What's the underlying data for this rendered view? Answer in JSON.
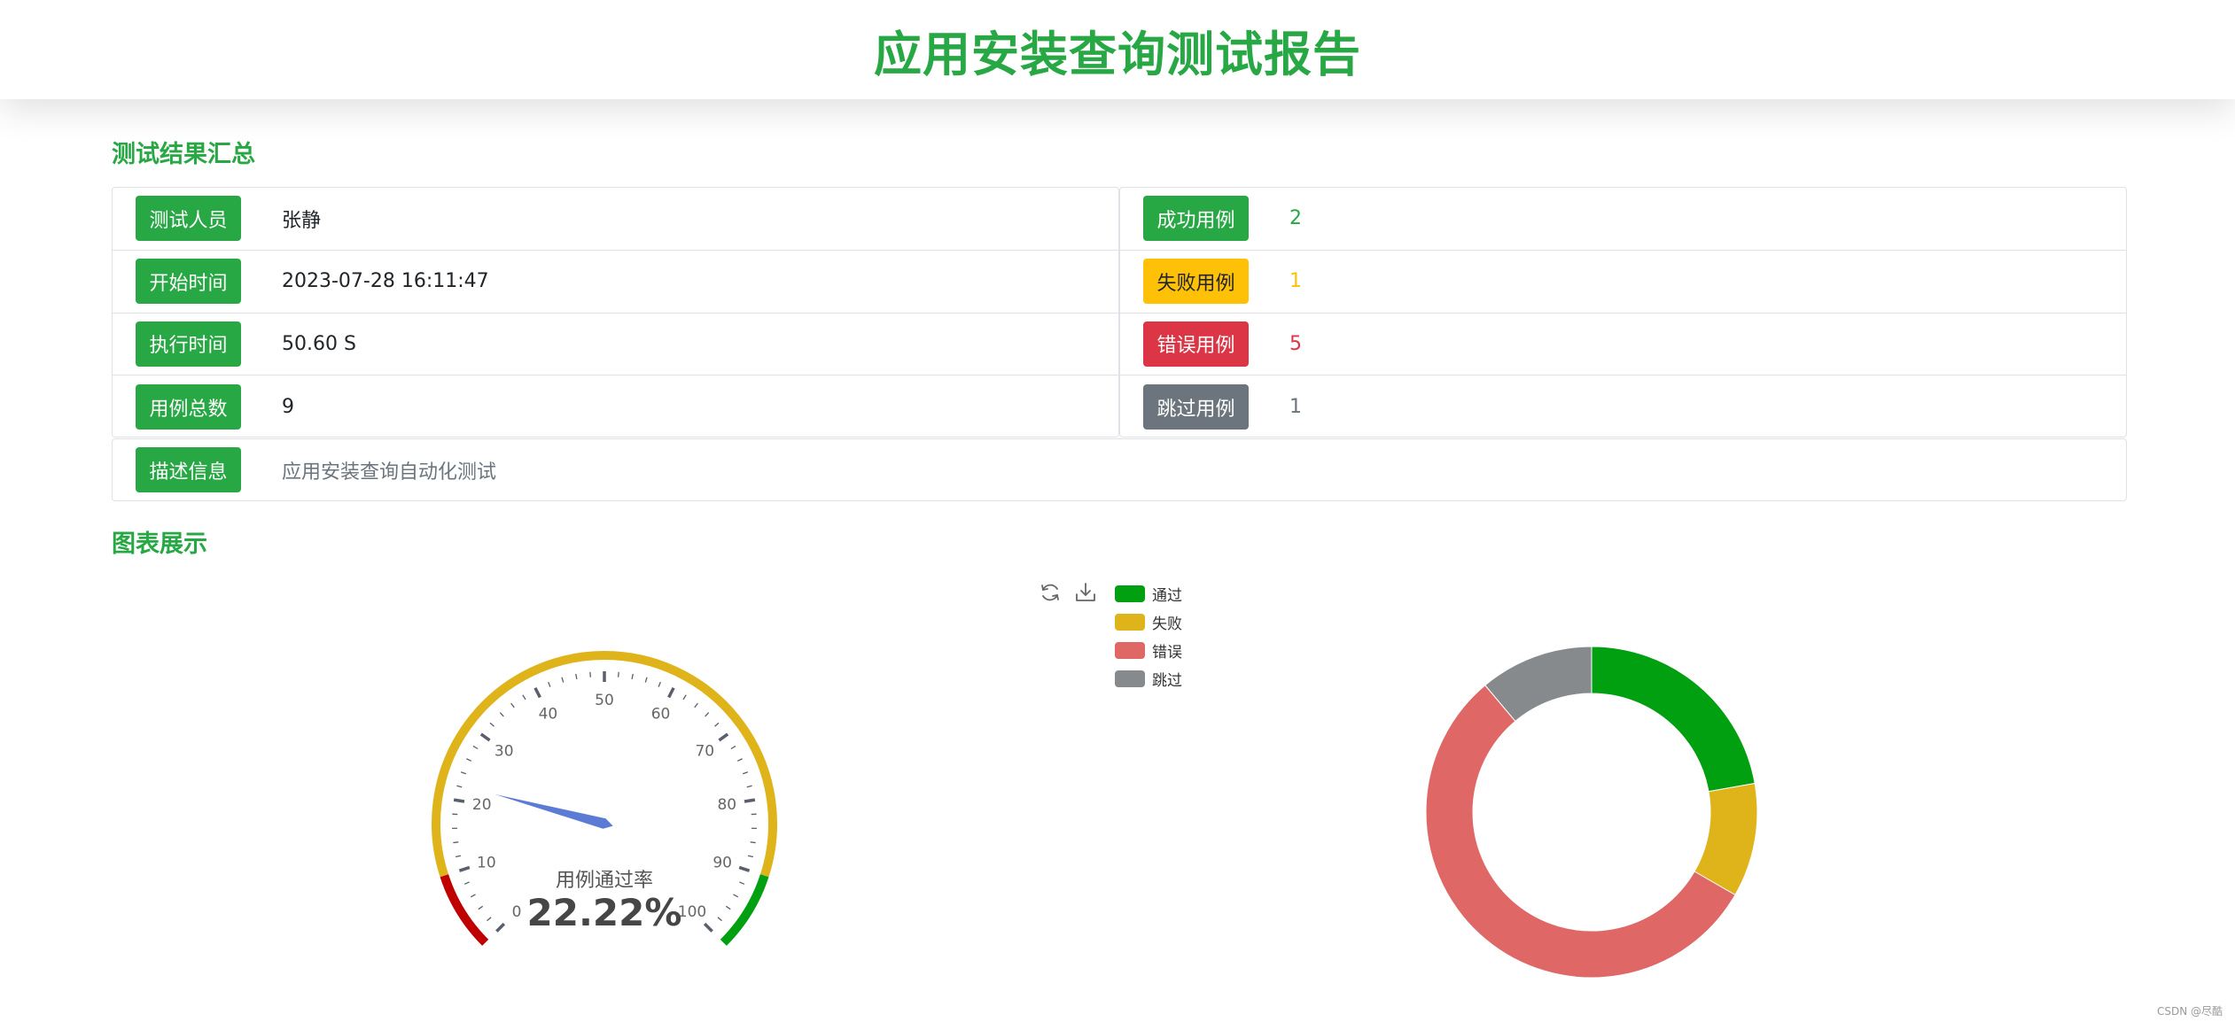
{
  "page": {
    "title": "应用安装查询测试报告"
  },
  "summary": {
    "title": "测试结果汇总",
    "tester_label": "测试人员",
    "tester": "张静",
    "start_label": "开始时间",
    "start": "2023-07-28 16:11:47",
    "duration_label": "执行时间",
    "duration": "50.60 S",
    "total_label": "用例总数",
    "total": "9",
    "success_label": "成功用例",
    "success": "2",
    "fail_label": "失败用例",
    "fail": "1",
    "error_label": "错误用例",
    "error": "5",
    "skip_label": "跳过用例",
    "skip": "1",
    "desc_label": "描述信息",
    "desc": "应用安装查询自动化测试"
  },
  "charts": {
    "title": "图表展示",
    "toolbox": {
      "restore_icon": "refresh-icon",
      "save_icon": "download-icon"
    }
  },
  "colors": {
    "pass": "#00a010",
    "fail": "#dfb41b",
    "error": "#df6766",
    "skip": "#878a8d",
    "gauge_low": "#c00000",
    "needle": "#5b7bd5"
  },
  "chart_data": [
    {
      "type": "gauge",
      "title": "用例通过率",
      "value": 22.22,
      "value_text": "22.22%",
      "min": 0,
      "max": 100,
      "tick_labels": [
        "0",
        "10",
        "20",
        "30",
        "40",
        "50",
        "60",
        "70",
        "80",
        "90",
        "100"
      ],
      "bands": [
        {
          "to": 10,
          "color": "#c00000"
        },
        {
          "to": 90,
          "color": "#dfb41b"
        },
        {
          "to": 100,
          "color": "#00a010"
        }
      ]
    },
    {
      "type": "pie",
      "donut": true,
      "legend": [
        "通过",
        "失败",
        "错误",
        "跳过"
      ],
      "legend_position": "top-left",
      "values": [
        2,
        1,
        5,
        1
      ],
      "colors": [
        "#00a010",
        "#dfb41b",
        "#df6766",
        "#878a8d"
      ]
    }
  ],
  "watermark": "CSDN @尽酷"
}
